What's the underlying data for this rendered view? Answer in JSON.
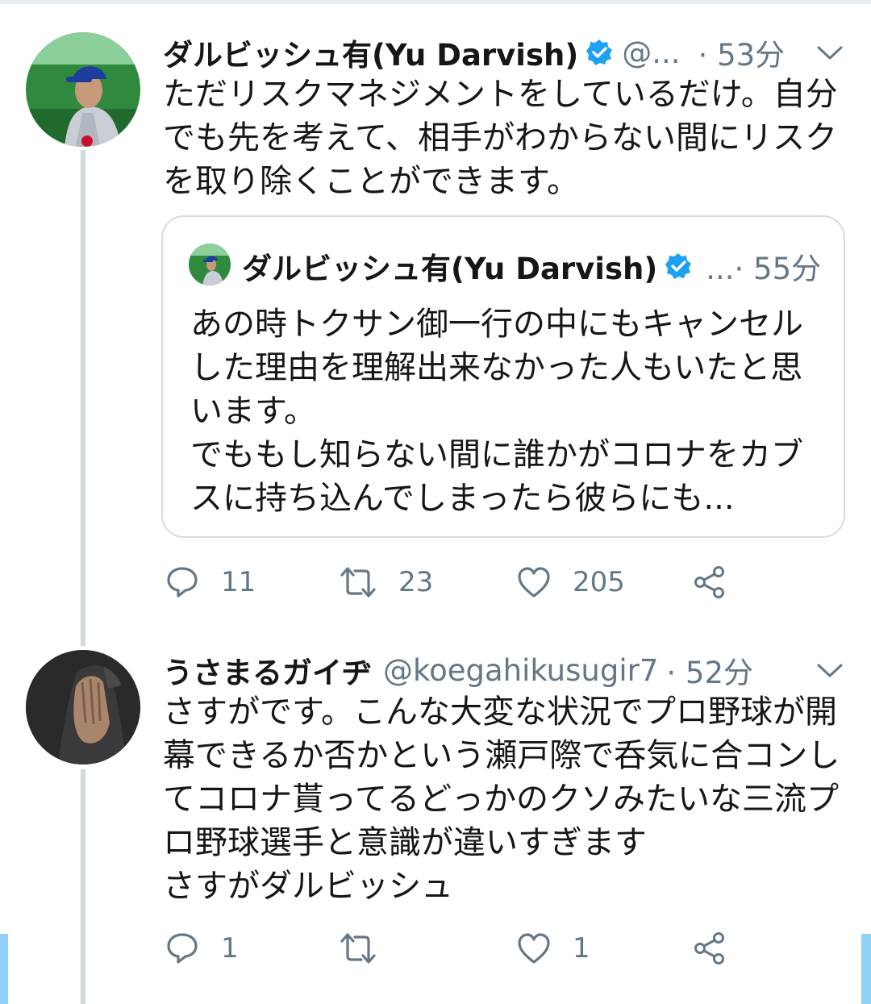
{
  "tweets": [
    {
      "author_name": "ダルビッシュ有(Yu Darvish)",
      "handle": "@...",
      "time": "· 53分",
      "text": "ただリスクマネジメントをしているだけ。自分でも先を考えて、相手がわからない間にリスクを取り除くことができます。",
      "quote": {
        "author_name": "ダルビッシュ有(Yu Darvish)",
        "meta": "...· 55分",
        "text": "あの時トクサン御一行の中にもキャンセルした理由を理解出来なかった人もいたと思います。\nでももし知らない間に誰かがコロナをカブスに持ち込んでしまったら彼らにも..."
      },
      "actions": {
        "replies": "11",
        "retweets": "23",
        "likes": "205"
      }
    },
    {
      "author_name": "うさまるガイヂ",
      "handle": "@koegahikusugir7",
      "time": "· 52分",
      "text": "さすがです。こんな大変な状況でプロ野球が開幕できるか否かという瀬戸際で呑気に合コンしてコロナ貰ってるどっかのクソみたいな三流プロ野球選手と意識が違いすぎます\nさすがダルビッシュ",
      "actions": {
        "replies": "1",
        "retweets": "",
        "likes": "1"
      }
    }
  ],
  "colors": {
    "verified": "#1da1f2",
    "secondary_text": "#657786",
    "thread_line": "#cfd9de"
  },
  "icons": [
    "verified-badge-icon",
    "chevron-down-icon",
    "reply-icon",
    "retweet-icon",
    "like-icon",
    "share-icon"
  ]
}
